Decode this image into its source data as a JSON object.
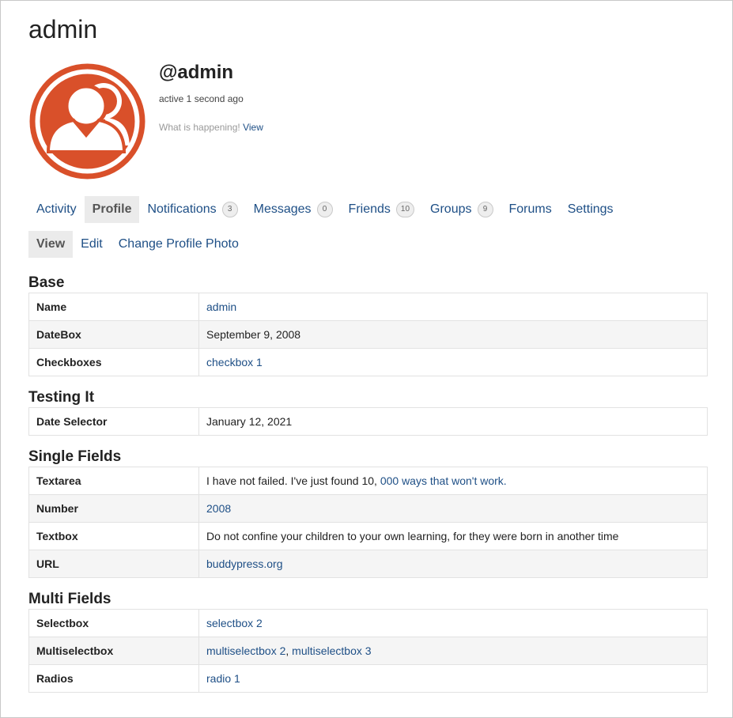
{
  "page": {
    "title": "admin"
  },
  "profile": {
    "handle": "@admin",
    "active": "active 1 second ago",
    "status_text": "What is happening!",
    "status_link": "View",
    "avatar_color": "#d9502a"
  },
  "nav": {
    "items": [
      {
        "label": "Activity",
        "badge": null
      },
      {
        "label": "Profile",
        "badge": null,
        "selected": true
      },
      {
        "label": "Notifications",
        "badge": "3"
      },
      {
        "label": "Messages",
        "badge": "0"
      },
      {
        "label": "Friends",
        "badge": "10"
      },
      {
        "label": "Groups",
        "badge": "9"
      },
      {
        "label": "Forums",
        "badge": null
      },
      {
        "label": "Settings",
        "badge": null
      }
    ]
  },
  "subnav": {
    "items": [
      {
        "label": "View",
        "selected": true
      },
      {
        "label": "Edit"
      },
      {
        "label": "Change Profile Photo"
      }
    ]
  },
  "groups": [
    {
      "title": "Base",
      "rows": [
        {
          "label": "Name",
          "value": "admin",
          "link": true
        },
        {
          "label": "DateBox",
          "value": "September 9, 2008",
          "link": false
        },
        {
          "label": "Checkboxes",
          "value": "checkbox 1",
          "link": true
        }
      ]
    },
    {
      "title": "Testing It",
      "rows": [
        {
          "label": "Date Selector",
          "value": "January 12, 2021",
          "link": false
        }
      ]
    },
    {
      "title": "Single Fields",
      "rows": [
        {
          "label": "Textarea",
          "value_plain": "I have not failed. I've just found 10, ",
          "value_link": "000 ways that won't work."
        },
        {
          "label": "Number",
          "value": "2008",
          "link": true
        },
        {
          "label": "Textbox",
          "value": "Do not confine your children to your own learning, for they were born in another time",
          "link": false
        },
        {
          "label": "URL",
          "value": "buddypress.org",
          "link": true
        }
      ]
    },
    {
      "title": "Multi Fields",
      "rows": [
        {
          "label": "Selectbox",
          "value": "selectbox 2",
          "link": true
        },
        {
          "label": "Multiselectbox",
          "value_link_a": "multiselectbox 2",
          "separator": ", ",
          "value_link_b": "multiselectbox 3"
        },
        {
          "label": "Radios",
          "value": "radio 1",
          "link": true
        }
      ]
    }
  ]
}
